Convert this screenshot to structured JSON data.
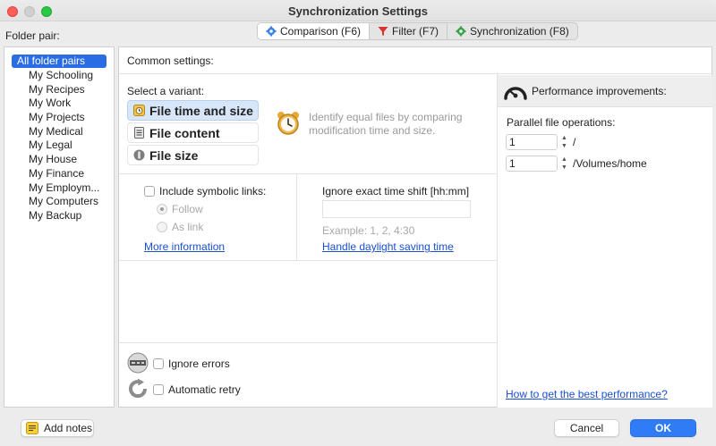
{
  "window": {
    "title": "Synchronization Settings"
  },
  "tabs": [
    {
      "label": "Comparison (F6)",
      "icon": "gears-icon",
      "active": true
    },
    {
      "label": "Filter (F7)",
      "icon": "funnel-icon",
      "active": false
    },
    {
      "label": "Synchronization (F8)",
      "icon": "green-gear-icon",
      "active": false
    }
  ],
  "folder_pair": {
    "label": "Folder pair:",
    "items": [
      "All folder pairs",
      "My Schooling",
      "My Recipes",
      "My Work",
      "My Projects",
      "My Medical",
      "My Legal",
      "My House",
      "My Finance",
      "My Employm...",
      "My Computers",
      "My Backup"
    ],
    "selected_index": 0
  },
  "comparison": {
    "common_settings_label": "Common settings:",
    "select_variant_label": "Select a variant:",
    "variants": [
      {
        "label": "File time and size",
        "icon": "alarm-clock-icon",
        "active": true
      },
      {
        "label": "File content",
        "icon": "document-icon",
        "active": false
      },
      {
        "label": "File size",
        "icon": "size-icon",
        "active": false
      }
    ],
    "variant_description": "Identify equal files by comparing modification time and size.",
    "symlinks": {
      "checkbox_label": "Include symbolic links:",
      "follow_label": "Follow",
      "as_link_label": "As link",
      "more_info_link": "More information"
    },
    "time_shift": {
      "label": "Ignore exact time shift [hh:mm]",
      "value": "",
      "example": "Example: 1, 2, 4:30",
      "daylight_link": "Handle daylight saving time"
    },
    "ignore_errors_label": "Ignore errors",
    "automatic_retry_label": "Automatic retry"
  },
  "performance": {
    "title": "Performance improvements:",
    "parallel_label": "Parallel file operations:",
    "rows": [
      {
        "value": "1",
        "path": "/"
      },
      {
        "value": "1",
        "path": "/Volumes/home"
      }
    ],
    "best_performance_link": "How to get the best performance?"
  },
  "footer": {
    "add_notes_label": "Add notes",
    "cancel_label": "Cancel",
    "ok_label": "OK"
  },
  "colors": {
    "accent": "#2a6ce3",
    "link": "#1a4fd0",
    "ok_button": "#2f7cf6"
  }
}
